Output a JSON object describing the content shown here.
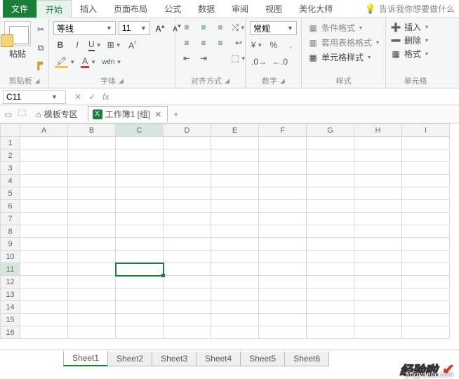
{
  "menu": {
    "file": "文件",
    "tabs": [
      "开始",
      "插入",
      "页面布局",
      "公式",
      "数据",
      "审阅",
      "视图",
      "美化大师"
    ],
    "active_index": 0,
    "tell_me": "告诉我你想要做什么"
  },
  "ribbon": {
    "clipboard": {
      "paste": "粘贴",
      "label": "剪贴板"
    },
    "font": {
      "name": "等线",
      "size": "11",
      "increase": "A",
      "decrease": "A",
      "bold": "B",
      "italic": "I",
      "underline": "U",
      "border": "⊞",
      "fill": "A",
      "fontcolor": "A",
      "phonetic": "wén",
      "label": "字体"
    },
    "alignment": {
      "label": "对齐方式"
    },
    "number": {
      "format": "常规",
      "currency": "%",
      "comma": "%",
      "percent": "%",
      "label": "数字"
    },
    "styles": {
      "conditional": "条件格式",
      "table": "套用表格格式",
      "cell": "单元格样式",
      "label": "样式"
    },
    "cells": {
      "insert": "插入",
      "delete": "删除",
      "format": "格式",
      "label": "单元格"
    }
  },
  "namebox": {
    "ref": "C11"
  },
  "fx": {
    "cancel": "✕",
    "confirm": "✓",
    "fx": "fx"
  },
  "wbtabs": {
    "template": "模板专区",
    "workbook": "工作簿1 [组]",
    "add": "+"
  },
  "columns": [
    "A",
    "B",
    "C",
    "D",
    "E",
    "F",
    "G",
    "H",
    "I"
  ],
  "rows": [
    "1",
    "2",
    "3",
    "4",
    "5",
    "6",
    "7",
    "8",
    "9",
    "10",
    "11",
    "12",
    "13",
    "14",
    "15",
    "16"
  ],
  "selected": {
    "col": 2,
    "row": 10
  },
  "sheets": [
    "Sheet1",
    "Sheet2",
    "Sheet3",
    "Sheet4",
    "Sheet5",
    "Sheet6"
  ],
  "active_sheet": 0,
  "watermark": {
    "text": "经验啦",
    "url": "jingyanla.com"
  }
}
